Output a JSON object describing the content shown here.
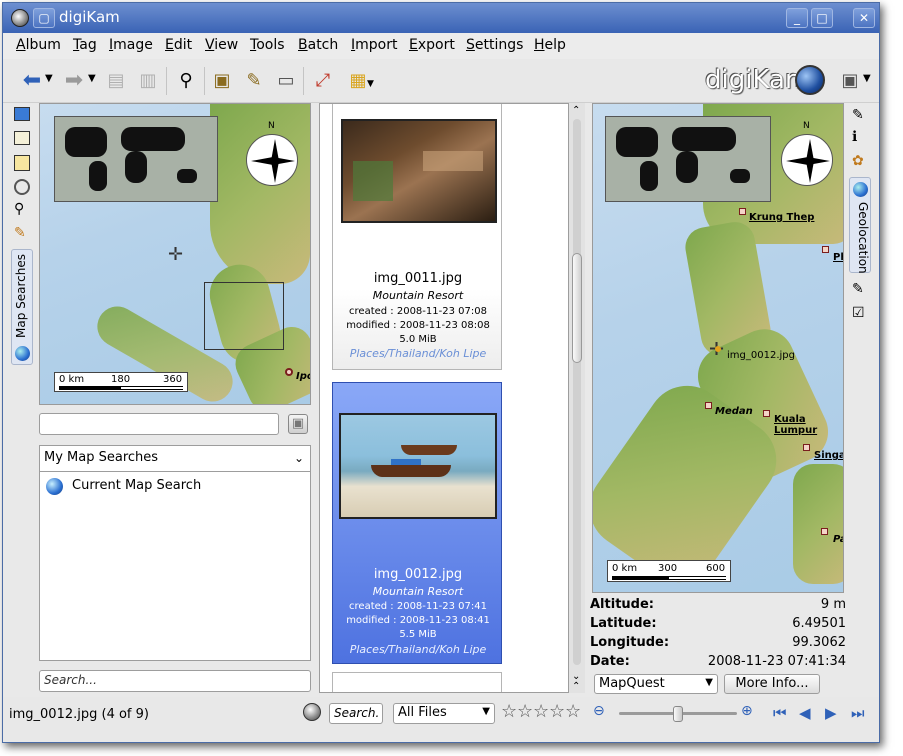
{
  "window": {
    "title": "digiKam"
  },
  "menu": [
    "Album",
    "Tag",
    "Image",
    "Edit",
    "View",
    "Tools",
    "Batch",
    "Import",
    "Export",
    "Settings",
    "Help"
  ],
  "branding": {
    "logo_text": "digiKam"
  },
  "left_sidebar": {
    "vertical_tab_label": "Map Searches"
  },
  "left_map": {
    "scale_labels": [
      "0 km",
      "180",
      "360"
    ],
    "place_partial": "Ipo",
    "compass_label": "N"
  },
  "map_search": {
    "name_input_value": "",
    "dropdown_value": "My Map Searches",
    "items": [
      {
        "label": "Current Map Search"
      }
    ],
    "search_placeholder": "Search..."
  },
  "thumbnails": [
    {
      "filename": "img_0011.jpg",
      "album": "Mountain Resort",
      "created": "created : 2008-11-23 07:08",
      "modified": "modified : 2008-11-23 08:08",
      "size": "5.0 MiB",
      "tags": "Places/Thailand/Koh Lipe",
      "selected": false
    },
    {
      "filename": "img_0012.jpg",
      "album": "Mountain Resort",
      "created": "created : 2008-11-23 07:41",
      "modified": "modified : 2008-11-23 08:41",
      "size": "5.5 MiB",
      "tags": "Places/Thailand/Koh Lipe",
      "selected": true
    }
  ],
  "right_map": {
    "places": [
      "Krung Thep",
      "Ph",
      "Medan",
      "Kuala Lumpur",
      "Singa",
      "Pa"
    ],
    "marker_label": "img_0012.jpg",
    "scale_labels": [
      "0 km",
      "300",
      "600"
    ],
    "compass_label": "N"
  },
  "geolocation": {
    "vertical_tab_label": "Geolocation",
    "fields": [
      {
        "label": "Altitude:",
        "value": "9 m"
      },
      {
        "label": "Latitude:",
        "value": "6.49501"
      },
      {
        "label": "Longitude:",
        "value": "99.3062"
      },
      {
        "label": "Date:",
        "value": "2008-11-23 07:41:34"
      }
    ],
    "provider": "MapQuest",
    "more_info_label": "More Info..."
  },
  "statusbar": {
    "status_text": "img_0012.jpg (4 of 9)",
    "search_label": "Search.",
    "filter_value": "All Files",
    "rating_stars": 5,
    "zoom_level": 0.5
  },
  "colors": {
    "titlebar": "#3a63b5",
    "selection": "#4e72e0",
    "tag_link": "#6a8fd6"
  }
}
